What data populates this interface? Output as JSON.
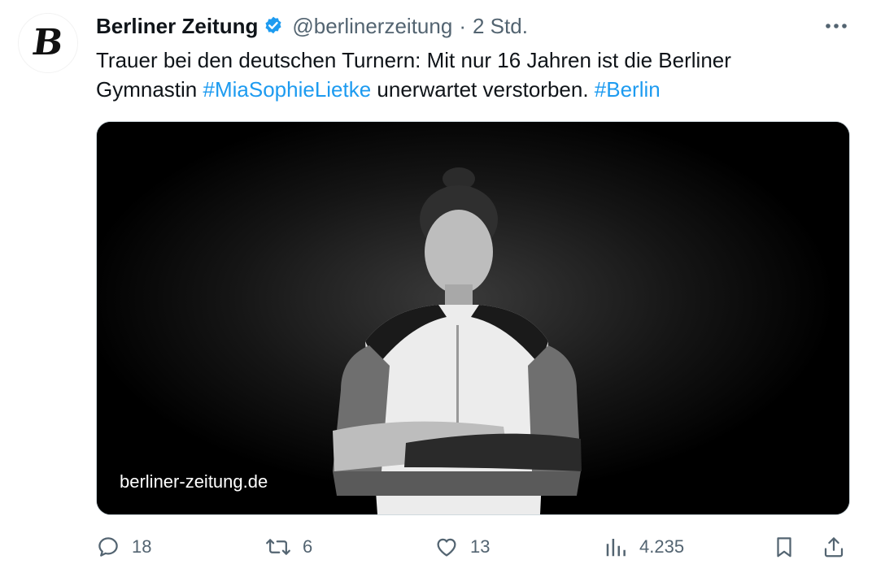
{
  "tweet": {
    "author_name": "Berliner Zeitung",
    "handle": "@berlinerzeitung",
    "separator": "·",
    "time": "2 Std.",
    "avatar_letter": "B",
    "text_part1": "Trauer bei den deutschen Turnern: Mit nur 16 Jahren ist die Berliner Gymnastin ",
    "hashtag1": "#MiaSophieLietke",
    "text_part2": " unerwartet verstorben. ",
    "hashtag2": "#Berlin",
    "link_label": "berliner-zeitung.de"
  },
  "actions": {
    "reply_count": "18",
    "retweet_count": "6",
    "like_count": "13",
    "views_count": "4.235"
  },
  "icons": {
    "avatar": "berliner-zeitung-logo",
    "verified": "verified-badge-icon",
    "more": "more-icon",
    "reply": "reply-icon",
    "retweet": "retweet-icon",
    "like": "heart-icon",
    "views": "views-chart-icon",
    "bookmark": "bookmark-icon",
    "share": "share-icon"
  },
  "colors": {
    "accent": "#1d9bf0",
    "text": "#0f1419",
    "muted": "#536471"
  }
}
